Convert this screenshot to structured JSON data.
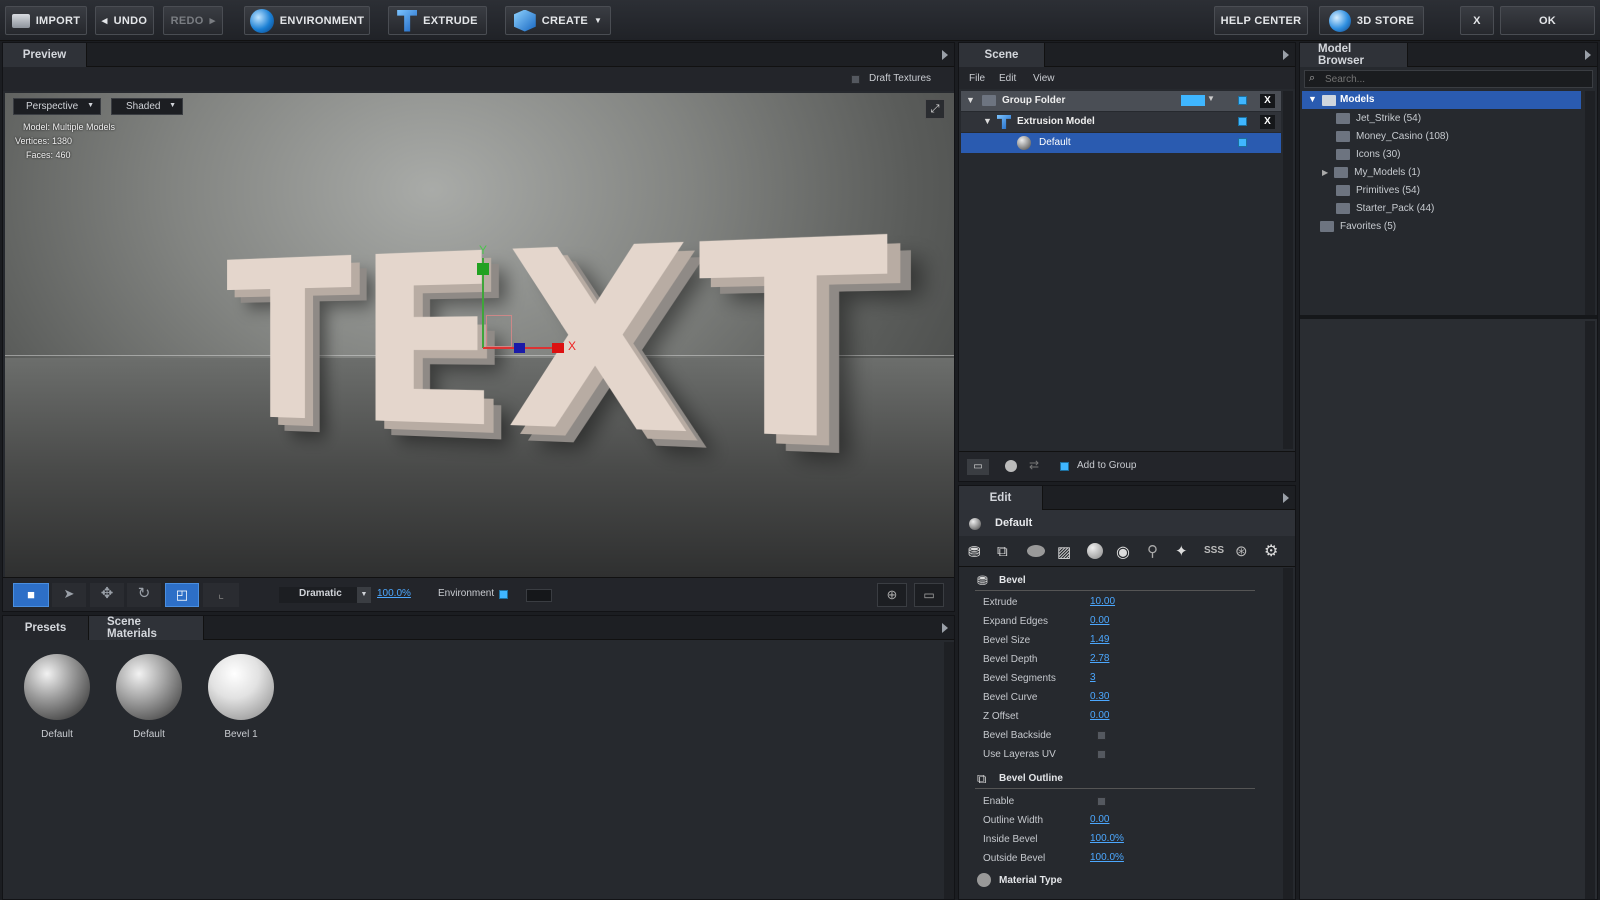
{
  "toolbar": {
    "import": "IMPORT",
    "undo": "UNDO",
    "redo": "REDO",
    "environment": "ENVIRONMENT",
    "extrude": "EXTRUDE",
    "create": "CREATE",
    "help_center": "HELP CENTER",
    "store": "3D STORE",
    "close": "X",
    "ok": "OK"
  },
  "preview": {
    "tab": "Preview",
    "draft_textures": "Draft Textures",
    "camera_mode": "Perspective",
    "render_mode": "Shaded",
    "info": {
      "model_label": "Model:",
      "model_value": "Multiple Models",
      "vertices_label": "Vertices:",
      "vertices_value": "1380",
      "faces_label": "Faces:",
      "faces_value": "460"
    },
    "scene_text": "TEXT",
    "gizmo_y": "Y",
    "gizmo_x": "X",
    "lighting_preset": "Dramatic",
    "lighting_intensity": "100.0%",
    "environment_label": "Environment"
  },
  "materials_panel": {
    "tabs": [
      "Presets",
      "Scene Materials"
    ],
    "items": [
      "Default",
      "Default",
      "Bevel 1"
    ]
  },
  "scene": {
    "tab": "Scene",
    "menu": [
      "File",
      "Edit",
      "View"
    ],
    "tree": [
      {
        "label": "Group Folder"
      },
      {
        "label": "Extrusion Model"
      },
      {
        "label": "Default"
      }
    ],
    "add_to_group": "Add to Group"
  },
  "model_browser": {
    "tab": "Model Browser",
    "search_placeholder": "Search...",
    "root": "Models",
    "items": [
      "Jet_Strike (54)",
      "Money_Casino (108)",
      "Icons (30)",
      "My_Models (1)",
      "Primitives (54)",
      "Starter_Pack (44)"
    ],
    "favorites": "Favorites (5)"
  },
  "edit": {
    "tab": "Edit",
    "material_name": "Default",
    "bevel_section": "Bevel",
    "bevel_props": [
      {
        "label": "Extrude",
        "value": "10.00"
      },
      {
        "label": "Expand Edges",
        "value": "0.00"
      },
      {
        "label": "Bevel Size",
        "value": "1.49"
      },
      {
        "label": "Bevel Depth",
        "value": "2.78"
      },
      {
        "label": "Bevel Segments",
        "value": "3"
      },
      {
        "label": "Bevel Curve",
        "value": "0.30"
      },
      {
        "label": "Z Offset",
        "value": "0.00"
      }
    ],
    "bevel_backside": "Bevel Backside",
    "use_layeras_uv": "Use Layeras UV",
    "outline_section": "Bevel Outline",
    "outline_enable": "Enable",
    "outline_props": [
      {
        "label": "Outline Width",
        "value": "0.00"
      },
      {
        "label": "Inside Bevel",
        "value": "100.0%"
      },
      {
        "label": "Outside Bevel",
        "value": "100.0%"
      }
    ],
    "material_type": "Material Type"
  },
  "colors": {
    "accent_blue": "#3fb6ff",
    "selection": "#2a5bb0",
    "link": "#4ca8ff"
  }
}
